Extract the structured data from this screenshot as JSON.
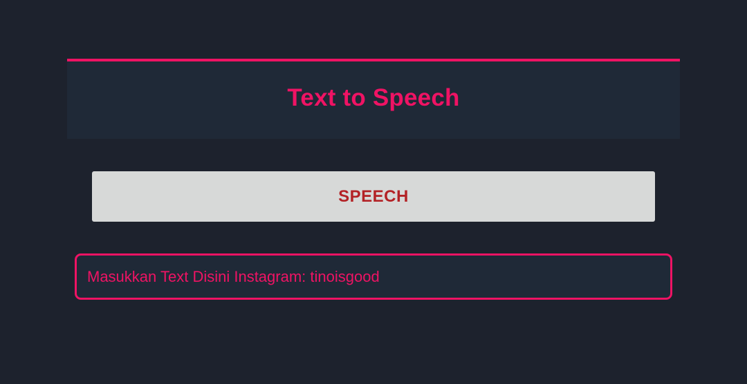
{
  "header": {
    "title": "Text to Speech"
  },
  "controls": {
    "speech_button_label": "SPEECH"
  },
  "input": {
    "placeholder": "Masukkan Text Disini Instagram: tinoisgood",
    "value": ""
  },
  "colors": {
    "background": "#1d222d",
    "panel": "#1f2937",
    "accent": "#ef1364",
    "button_bg": "#d7d9d8",
    "button_text": "#b32226"
  }
}
